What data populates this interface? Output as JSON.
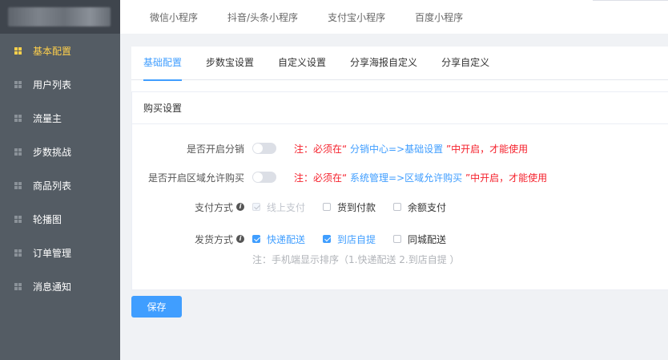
{
  "sidebar": {
    "items": [
      {
        "label": "基本配置",
        "active": true
      },
      {
        "label": "用户列表",
        "active": false
      },
      {
        "label": "流量主",
        "active": false
      },
      {
        "label": "步数挑战",
        "active": false
      },
      {
        "label": "商品列表",
        "active": false
      },
      {
        "label": "轮播图",
        "active": false
      },
      {
        "label": "订单管理",
        "active": false
      },
      {
        "label": "消息通知",
        "active": false
      }
    ]
  },
  "topnav": {
    "tabs": [
      "微信小程序",
      "抖音/头条小程序",
      "支付宝小程序",
      "百度小程序"
    ]
  },
  "subtabs": [
    "基础配置",
    "步数宝设置",
    "自定义设置",
    "分享海报自定义",
    "分享自定义"
  ],
  "panel": {
    "title": "购买设置",
    "distribution": {
      "label": "是否开启分销",
      "enabled": false,
      "note_prefix": "注：必须在“",
      "note_highlight": " 分销中心=>基础设置 ",
      "note_suffix": "”中开启，才能使用"
    },
    "region": {
      "label": "是否开启区域允许购买",
      "enabled": false,
      "note_prefix": "注：必须在“",
      "note_highlight": " 系统管理=>区域允许购买 ",
      "note_suffix": "”中开启，才能使用"
    },
    "payment": {
      "label": "支付方式",
      "options": [
        {
          "label": "线上支付",
          "checked": true,
          "disabled": true
        },
        {
          "label": "货到付款",
          "checked": false,
          "disabled": false
        },
        {
          "label": "余额支付",
          "checked": false,
          "disabled": false
        }
      ]
    },
    "shipping": {
      "label": "发货方式",
      "options": [
        {
          "label": "快递配送",
          "checked": true,
          "disabled": false
        },
        {
          "label": "到店自提",
          "checked": true,
          "disabled": false
        },
        {
          "label": "同城配送",
          "checked": false,
          "disabled": false
        }
      ],
      "hint": "注：手机端显示排序（1.快递配送 2.到店自提 ）"
    }
  },
  "save_label": "保存",
  "colors": {
    "accent": "#409eff",
    "sidebar": "#545c64",
    "active_menu": "#ffd04b",
    "warning": "#f5222d"
  }
}
